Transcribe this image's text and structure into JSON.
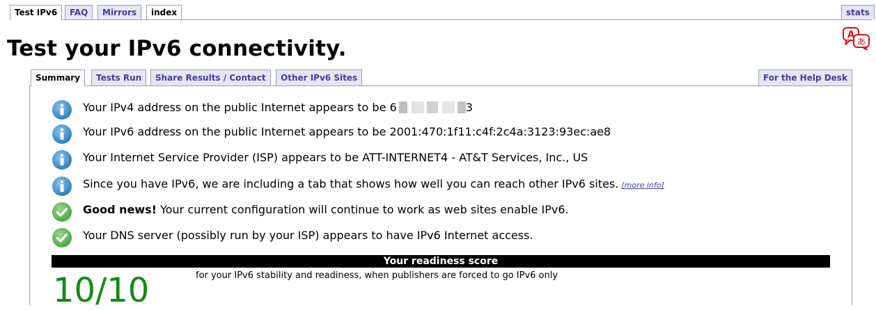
{
  "top_nav": {
    "tabs": [
      "Test IPv6",
      "FAQ",
      "Mirrors",
      "index"
    ],
    "active": "Test IPv6",
    "stats_label": "stats"
  },
  "page_title": "Test your IPv6 connectivity.",
  "inner_tabs": {
    "tabs": [
      "Summary",
      "Tests Run",
      "Share Results / Contact",
      "Other IPv6 Sites"
    ],
    "active": "Summary",
    "help_desk_label": "For the Help Desk"
  },
  "messages": [
    {
      "icon": "info-icon",
      "prefix": "Your IPv4 address on the public Internet appears to be ",
      "ipv4_first": "6",
      "ipv4_last": "3"
    },
    {
      "icon": "info-icon",
      "text": "Your IPv6 address on the public Internet appears to be 2001:470:1f11:c4f:2c4a:3123:93ec:ae8"
    },
    {
      "icon": "info-icon",
      "text": "Your Internet Service Provider (ISP) appears to be ATT-INTERNET4 - AT&T Services, Inc., US"
    },
    {
      "icon": "info-icon",
      "text": "Since you have IPv6, we are including a tab that shows how well you can reach other IPv6 sites.",
      "link": "[more info]"
    },
    {
      "icon": "check-icon",
      "bold": "Good news!",
      "text": " Your current configuration will continue to work as web sites enable IPv6."
    },
    {
      "icon": "check-icon",
      "text": "Your DNS server (possibly run by your ISP) appears to have IPv6 Internet access."
    }
  ],
  "readiness": {
    "header": "Your readiness score",
    "score": "10/10",
    "description": "for your IPv6 stability and readiness, when publishers are forced to go IPv6 only"
  },
  "colors": {
    "tab_inactive_bg": "#e6e6f3",
    "tab_inactive_text": "#3f3fa6",
    "score_green": "#138a13",
    "info_blue": "#2a7fc0",
    "check_green": "#4aa843"
  }
}
